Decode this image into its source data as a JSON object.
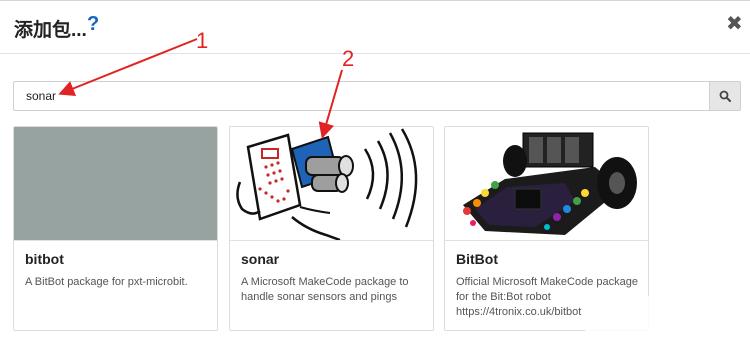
{
  "dialog": {
    "title": "添加包...",
    "help_icon": "question-mark-icon",
    "help_label": "?",
    "close_icon": "close-icon",
    "close_label": "✖"
  },
  "search": {
    "value": "sonar",
    "icon": "search-icon"
  },
  "packages": [
    {
      "name": "bitbot",
      "description": "A BitBot package for pxt-microbit.",
      "image": "gray-placeholder",
      "image_color": "#96a3a0"
    },
    {
      "name": "sonar",
      "description": "A Microsoft MakeCode package to handle sonar sensors and pings",
      "image": "sonar-sensor-drawing"
    },
    {
      "name": "BitBot",
      "description": "Official Microsoft MakeCode package for the Bit:Bot robot https://4tronix.co.uk/bitbot",
      "image": "bitbot-robot-photo"
    }
  ],
  "annotations": {
    "label_1": "1",
    "label_2": "2",
    "color": "#e02424"
  }
}
